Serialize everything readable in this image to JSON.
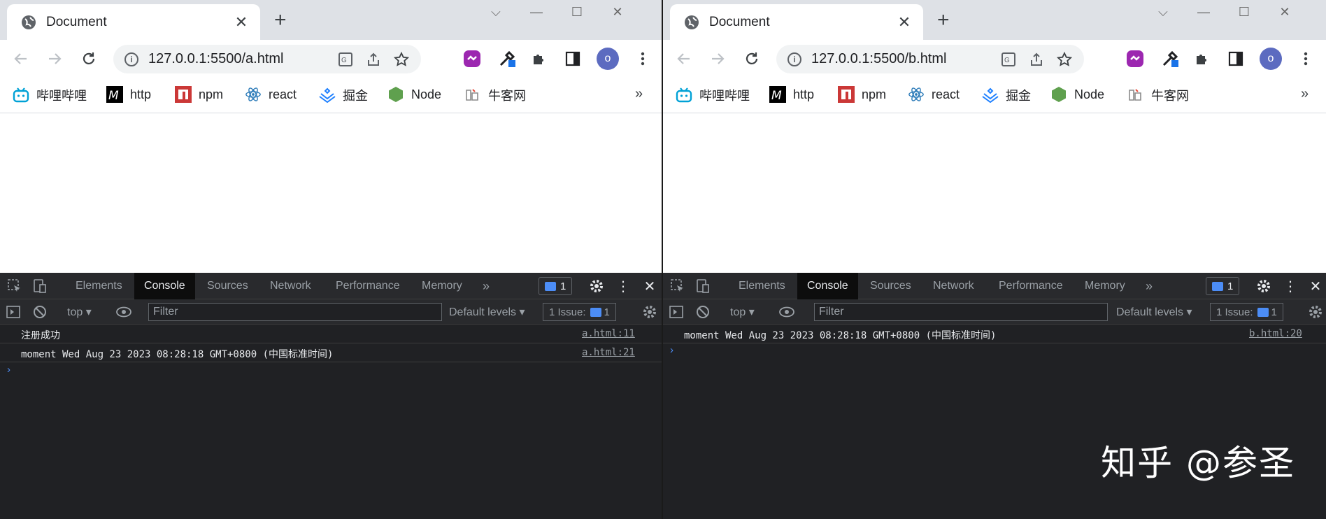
{
  "windows": [
    {
      "id": "a",
      "tab_title": "Document",
      "url": "127.0.0.1:5500/a.html",
      "avatar": "o",
      "bookmarks": [
        {
          "label": "哔哩哔哩",
          "icon": "bilibili-icon"
        },
        {
          "label": "http",
          "icon": "m-icon"
        },
        {
          "label": "npm",
          "icon": "npm-icon"
        },
        {
          "label": "react",
          "icon": "react-icon"
        },
        {
          "label": "掘金",
          "icon": "juejin-icon"
        },
        {
          "label": "Node",
          "icon": "node-icon"
        },
        {
          "label": "牛客网",
          "icon": "nowcoder-icon"
        }
      ],
      "devtools": {
        "tabs": [
          "Elements",
          "Console",
          "Sources",
          "Network",
          "Performance",
          "Memory"
        ],
        "active_tab": "Console",
        "message_count": "1",
        "context": "top",
        "filter_placeholder": "Filter",
        "levels": "Default levels",
        "issues": "1 Issue:",
        "issues_count": "1",
        "logs": [
          {
            "text": "注册成功",
            "source": "a.html:11"
          },
          {
            "text": "moment Wed Aug 23 2023 08:28:18 GMT+0800 (中国标准时间)",
            "source": "a.html:21"
          }
        ]
      }
    },
    {
      "id": "b",
      "tab_title": "Document",
      "url": "127.0.0.1:5500/b.html",
      "avatar": "o",
      "bookmarks": [
        {
          "label": "哔哩哔哩",
          "icon": "bilibili-icon"
        },
        {
          "label": "http",
          "icon": "m-icon"
        },
        {
          "label": "npm",
          "icon": "npm-icon"
        },
        {
          "label": "react",
          "icon": "react-icon"
        },
        {
          "label": "掘金",
          "icon": "juejin-icon"
        },
        {
          "label": "Node",
          "icon": "node-icon"
        },
        {
          "label": "牛客网",
          "icon": "nowcoder-icon"
        }
      ],
      "devtools": {
        "tabs": [
          "Elements",
          "Console",
          "Sources",
          "Network",
          "Performance",
          "Memory"
        ],
        "active_tab": "Console",
        "message_count": "1",
        "context": "top",
        "filter_placeholder": "Filter",
        "levels": "Default levels",
        "issues": "1 Issue:",
        "issues_count": "1",
        "logs": [
          {
            "text": "moment Wed Aug 23 2023 08:28:18 GMT+0800 (中国标准时间)",
            "source": "b.html:20"
          }
        ]
      }
    }
  ],
  "watermark": "知乎 @参圣",
  "colors": {
    "accent": "#4c8df6",
    "avatar": "#5c6bc0",
    "devtools_bg": "#202124"
  }
}
